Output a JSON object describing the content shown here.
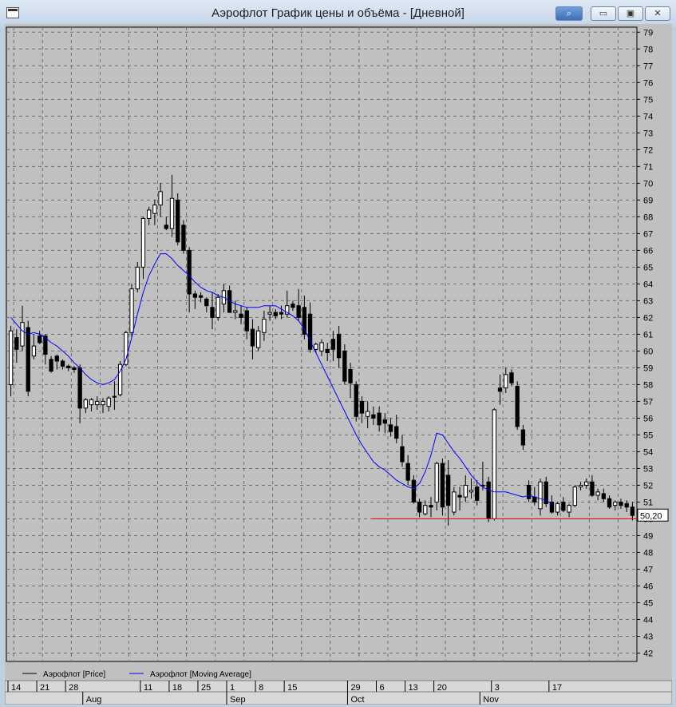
{
  "window": {
    "title": "Аэрофлот График цены и объёма - [Дневной]",
    "buttons": [
      "pin",
      "minimize",
      "maximize",
      "close"
    ]
  },
  "chart_data": {
    "type": "candlestick",
    "title": "Аэрофлот График цены и объёма - [Дневной]",
    "ylim": [
      41.5,
      79.3
    ],
    "y_ticks": [
      79,
      78,
      77,
      76,
      75,
      74,
      73,
      72,
      71,
      70,
      69,
      68,
      67,
      66,
      65,
      64,
      63,
      62,
      61,
      60,
      59,
      58,
      57,
      56,
      55,
      54,
      53,
      52,
      51,
      50,
      49,
      48,
      47,
      46,
      45,
      44,
      43,
      42
    ],
    "y_tick_labels": [
      "79",
      "78",
      "77",
      "76",
      "75",
      "74",
      "73",
      "72",
      "71",
      "70",
      "69",
      "68",
      "67",
      "66",
      "65",
      "64",
      "63",
      "62",
      "61",
      "60",
      "59",
      "58",
      "57",
      "56",
      "55",
      "54",
      "53",
      "52",
      "51",
      "50",
      "49",
      "48",
      "47",
      "46",
      "45",
      "44",
      "43",
      "42"
    ],
    "x_tick_labels": [
      {
        "label": "14",
        "bar": 0
      },
      {
        "label": "21",
        "bar": 5
      },
      {
        "label": "28",
        "bar": 10
      },
      {
        "label": "11",
        "bar": 23
      },
      {
        "label": "18",
        "bar": 28
      },
      {
        "label": "25",
        "bar": 33
      },
      {
        "label": "1",
        "bar": 38
      },
      {
        "label": "8",
        "bar": 43
      },
      {
        "label": "15",
        "bar": 48
      },
      {
        "label": "29",
        "bar": 59
      },
      {
        "label": "6",
        "bar": 64
      },
      {
        "label": "13",
        "bar": 69
      },
      {
        "label": "20",
        "bar": 74
      },
      {
        "label": "3",
        "bar": 84
      },
      {
        "label": "17",
        "bar": 94
      }
    ],
    "month_labels": [
      {
        "label": "Aug",
        "bar": 13
      },
      {
        "label": "Sep",
        "bar": 38
      },
      {
        "label": "Oct",
        "bar": 59
      },
      {
        "label": "Nov",
        "bar": 82
      }
    ],
    "series": [
      {
        "name": "Аэрофлот [Price]",
        "color": "#000000",
        "ohlc": [
          [
            58.0,
            61.5,
            57.3,
            61.2
          ],
          [
            60.8,
            61.3,
            59.3,
            60.1
          ],
          [
            60.3,
            62.7,
            60.0,
            61.7
          ],
          [
            61.4,
            61.8,
            57.3,
            57.6
          ],
          [
            59.7,
            61.0,
            59.5,
            60.3
          ],
          [
            60.9,
            61.2,
            60.4,
            60.5
          ],
          [
            60.9,
            61.0,
            59.2,
            59.8
          ],
          [
            59.5,
            59.7,
            58.7,
            58.8
          ],
          [
            59.7,
            59.8,
            58.9,
            59.4
          ],
          [
            59.4,
            59.5,
            58.9,
            59.1
          ],
          [
            59.1,
            59.2,
            58.8,
            59.0
          ],
          [
            59.0,
            59.1,
            58.7,
            58.9
          ],
          [
            59.0,
            59.2,
            55.7,
            56.6
          ],
          [
            56.6,
            57.2,
            56.3,
            57.1
          ],
          [
            56.8,
            57.2,
            56.4,
            57.1
          ],
          [
            56.8,
            57.3,
            56.5,
            57.0
          ],
          [
            56.8,
            57.2,
            56.3,
            57.0
          ],
          [
            56.7,
            57.3,
            56.4,
            57.2
          ],
          [
            57.3,
            58.2,
            56.5,
            57.3
          ],
          [
            57.4,
            59.4,
            57.3,
            59.2
          ],
          [
            59.2,
            61.2,
            59.1,
            61.1
          ],
          [
            61.1,
            64.0,
            60.8,
            63.7
          ],
          [
            63.7,
            65.3,
            63.5,
            65.0
          ],
          [
            65.0,
            68.0,
            64.3,
            67.9
          ],
          [
            67.9,
            68.6,
            67.5,
            68.4
          ],
          [
            68.2,
            69.0,
            67.5,
            68.7
          ],
          [
            68.7,
            70.0,
            68.0,
            69.5
          ],
          [
            67.5,
            68.0,
            67.2,
            67.3
          ],
          [
            67.3,
            70.5,
            66.8,
            69.1
          ],
          [
            69.0,
            69.4,
            66.3,
            66.5
          ],
          [
            67.5,
            67.8,
            65.8,
            66.0
          ],
          [
            66.0,
            66.2,
            62.3,
            63.4
          ],
          [
            63.4,
            63.6,
            62.5,
            63.2
          ],
          [
            63.3,
            63.5,
            62.9,
            63.2
          ],
          [
            63.1,
            63.2,
            62.3,
            62.7
          ],
          [
            62.6,
            63.5,
            61.3,
            62.0
          ],
          [
            62.0,
            63.4,
            61.8,
            63.2
          ],
          [
            62.8,
            64.0,
            62.3,
            63.6
          ],
          [
            63.6,
            63.9,
            62.3,
            62.3
          ],
          [
            62.3,
            63.0,
            61.9,
            62.4
          ],
          [
            62.2,
            62.7,
            61.6,
            62.0
          ],
          [
            62.4,
            62.6,
            60.7,
            61.2
          ],
          [
            61.3,
            61.9,
            59.5,
            60.3
          ],
          [
            60.2,
            61.5,
            60.0,
            61.2
          ],
          [
            61.1,
            62.4,
            60.6,
            61.9
          ],
          [
            62.2,
            62.7,
            61.8,
            62.3
          ],
          [
            62.3,
            62.5,
            61.9,
            62.1
          ],
          [
            62.3,
            62.7,
            61.9,
            62.2
          ],
          [
            62.2,
            63.6,
            62.0,
            62.7
          ],
          [
            62.8,
            63.0,
            62.4,
            62.6
          ],
          [
            62.7,
            63.7,
            61.8,
            62.0
          ],
          [
            62.6,
            63.3,
            60.7,
            61.0
          ],
          [
            62.2,
            62.9,
            59.9,
            60.1
          ],
          [
            60.1,
            60.5,
            59.9,
            60.4
          ],
          [
            60.0,
            60.7,
            59.7,
            60.5
          ],
          [
            60.1,
            60.5,
            59.4,
            59.9
          ],
          [
            60.7,
            61.2,
            59.4,
            60.1
          ],
          [
            61.0,
            61.5,
            59.0,
            59.6
          ],
          [
            60.0,
            60.4,
            58.0,
            58.2
          ],
          [
            58.9,
            59.3,
            57.2,
            58.1
          ],
          [
            58.0,
            58.2,
            55.8,
            56.1
          ],
          [
            57.0,
            57.3,
            55.7,
            56.3
          ],
          [
            56.1,
            57.0,
            55.4,
            56.4
          ],
          [
            56.2,
            56.7,
            55.6,
            56.0
          ],
          [
            56.3,
            56.7,
            55.2,
            55.6
          ],
          [
            55.9,
            56.3,
            55.1,
            55.7
          ],
          [
            55.6,
            56.0,
            54.9,
            55.2
          ],
          [
            55.5,
            56.2,
            54.5,
            54.8
          ],
          [
            54.3,
            55.0,
            53.1,
            53.4
          ],
          [
            53.3,
            53.8,
            52.0,
            52.3
          ],
          [
            52.3,
            52.6,
            50.9,
            51.0
          ],
          [
            51.0,
            51.2,
            50.1,
            50.4
          ],
          [
            50.3,
            51.1,
            50.2,
            50.8
          ],
          [
            50.8,
            51.3,
            50.1,
            50.7
          ],
          [
            51.0,
            53.4,
            50.5,
            53.3
          ],
          [
            53.3,
            53.6,
            50.2,
            50.7
          ],
          [
            52.6,
            53.5,
            49.6,
            50.8
          ],
          [
            50.4,
            51.9,
            50.2,
            51.6
          ],
          [
            51.4,
            51.9,
            50.5,
            51.3
          ],
          [
            51.3,
            52.6,
            51.0,
            52.0
          ],
          [
            51.6,
            52.4,
            51.2,
            51.7
          ],
          [
            51.9,
            52.3,
            50.8,
            51.1
          ],
          [
            52.0,
            53.4,
            51.7,
            52.0
          ],
          [
            52.2,
            52.5,
            49.8,
            50.0
          ],
          [
            50.0,
            56.6,
            49.9,
            56.5
          ],
          [
            57.8,
            58.6,
            56.8,
            57.6
          ],
          [
            57.8,
            59.0,
            57.5,
            58.6
          ],
          [
            58.7,
            58.9,
            57.9,
            58.1
          ]
        ]
      },
      {
        "name": "Аэрофлот [Moving Average]",
        "color": "#0000ff",
        "values": [
          62.0,
          61.6,
          61.2,
          61.0,
          61.1,
          61.0,
          60.8,
          60.5,
          60.3,
          60.0,
          59.7,
          59.3,
          59.0,
          58.6,
          58.3,
          58.1,
          58.0,
          58.1,
          58.3,
          58.8,
          59.5,
          60.8,
          62.2,
          63.5,
          64.5,
          65.2,
          65.8,
          65.8,
          65.5,
          65.1,
          64.8,
          64.5,
          64.1,
          63.8,
          63.6,
          63.5,
          63.3,
          63.2,
          63.0,
          62.8,
          62.7,
          62.6,
          62.6,
          62.6,
          62.7,
          62.7,
          62.7,
          62.5,
          62.3,
          62.1,
          61.8,
          61.3,
          60.6,
          59.9,
          59.2,
          58.5,
          57.8,
          57.1,
          56.4,
          55.7,
          55.0,
          54.4,
          53.9,
          53.4,
          53.1,
          52.9,
          52.6,
          52.3,
          52.1,
          51.9,
          51.8,
          52.1,
          52.8,
          53.8,
          55.1,
          55.0,
          54.5,
          54.0,
          53.6,
          53.1,
          52.6,
          52.2,
          51.9,
          51.7,
          51.6,
          51.6,
          51.6,
          51.5,
          51.4,
          51.3,
          51.4,
          51.3,
          51.2,
          51.1,
          50.9
        ]
      }
    ],
    "tail_ohlc": [
      [
        57.9,
        58.2,
        55.3,
        55.5
      ],
      [
        55.3,
        55.6,
        54.1,
        54.4
      ],
      [
        52.0,
        52.3,
        51.0,
        51.2
      ],
      [
        51.3,
        51.9,
        50.8,
        51.0
      ],
      [
        50.6,
        52.4,
        50.2,
        52.2
      ],
      [
        52.2,
        52.5,
        50.7,
        50.9
      ],
      [
        51.0,
        51.4,
        50.3,
        50.4
      ],
      [
        50.4,
        51.0,
        50.2,
        50.9
      ],
      [
        51.0,
        51.3,
        50.4,
        50.5
      ],
      [
        50.4,
        50.9,
        50.1,
        50.8
      ],
      [
        50.8,
        52.0,
        50.7,
        51.9
      ],
      [
        51.9,
        52.2,
        51.7,
        52.0
      ],
      [
        52.0,
        52.4,
        51.8,
        52.2
      ],
      [
        52.2,
        52.6,
        51.3,
        51.4
      ],
      [
        51.4,
        51.8,
        51.1,
        51.6
      ],
      [
        51.5,
        51.8,
        51.0,
        51.2
      ],
      [
        51.2,
        51.4,
        50.6,
        50.7
      ],
      [
        50.8,
        51.1,
        50.5,
        51.0
      ],
      [
        51.0,
        51.2,
        50.6,
        50.8
      ],
      [
        50.9,
        51.1,
        50.4,
        50.7
      ],
      [
        50.7,
        51.0,
        49.9,
        50.2
      ]
    ],
    "horizontal_line": {
      "value": 50.0,
      "color": "#e01010"
    },
    "last_price_label": "50,20",
    "legend": {
      "placement": "bottom-left"
    },
    "grid": true
  }
}
